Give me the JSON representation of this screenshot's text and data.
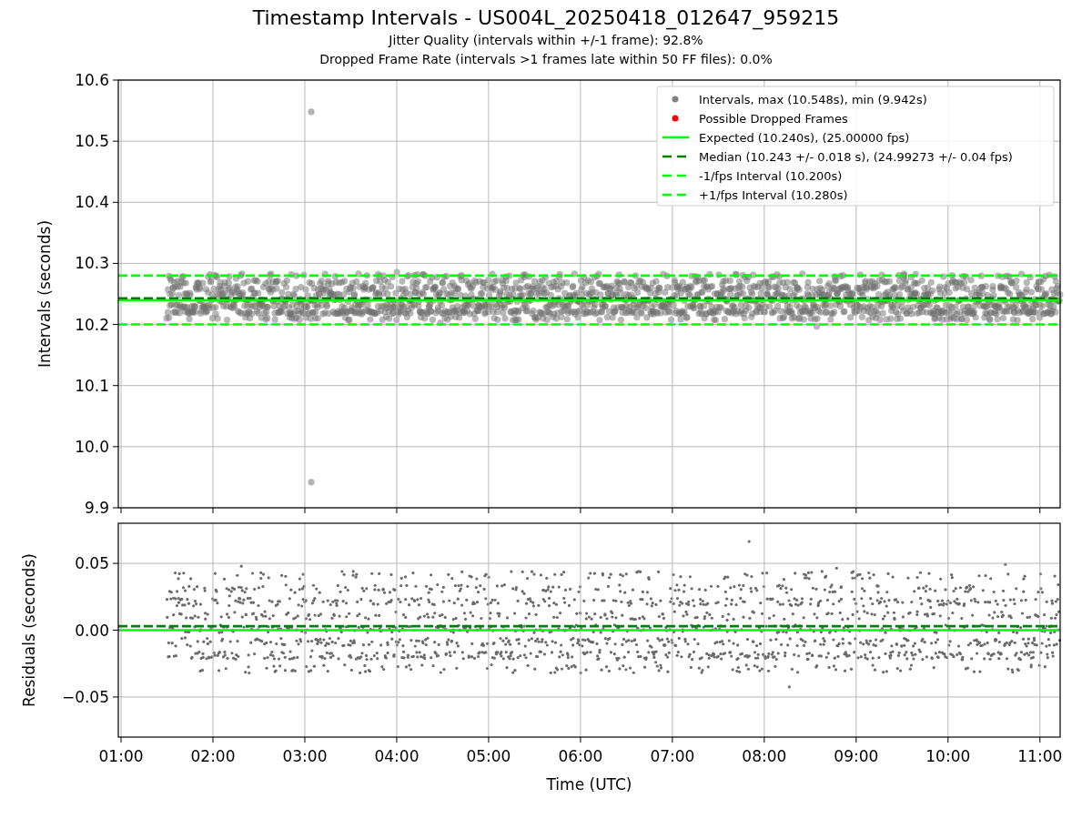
{
  "figure": {
    "title": "Timestamp Intervals - US004L_20250418_012647_959215",
    "subtitles": [
      "Jitter Quality (intervals within +/-1 frame): 92.8%",
      "Dropped Frame Rate (intervals >1 frames late within 50 FF files): 0.0%"
    ]
  },
  "top_panel": {
    "chart_data": {
      "type": "scatter",
      "ylabel": "Intervals (seconds)",
      "grid": true,
      "legend": "upper right",
      "xlim": [
        0.97,
        11.22
      ],
      "ylim": [
        9.9,
        10.6
      ],
      "yticks": [
        {
          "value": 9.9,
          "label": "9.9"
        },
        {
          "value": 10.0,
          "label": "10.0"
        },
        {
          "value": 10.1,
          "label": "10.1"
        },
        {
          "value": 10.2,
          "label": "10.2"
        },
        {
          "value": 10.3,
          "label": "10.3"
        },
        {
          "value": 10.4,
          "label": "10.4"
        },
        {
          "value": 10.5,
          "label": "10.5"
        },
        {
          "value": 10.6,
          "label": "10.6"
        }
      ],
      "series": [
        {
          "name": "Intervals, max (10.548s), min (9.942s)",
          "color": "#808080",
          "type": "scatter",
          "x": [
            3.07,
            3.07
          ],
          "values": [
            10.548,
            9.942
          ]
        },
        {
          "name": "Possible Dropped Frames",
          "color": "#ff0000",
          "type": "scatter"
        },
        {
          "name": "Expected (10.240s), (25.00000 fps)",
          "color": "#00ff00",
          "type": "line",
          "line_style": "solid",
          "x": [
            0.97,
            11.22
          ],
          "values": [
            10.24,
            10.24
          ]
        },
        {
          "name": "Median (10.243 +/- 0.018 s), (24.99273 +/- 0.04 fps)",
          "color": "#008000",
          "type": "line",
          "line_style": "dashed",
          "x": [
            0.97,
            11.22
          ],
          "values": [
            10.243,
            10.243
          ]
        },
        {
          "name": "-1/fps Interval (10.200s)",
          "color": "#00ff00",
          "type": "line",
          "line_style": "dashed",
          "x": [
            0.97,
            11.22
          ],
          "values": [
            10.2,
            10.2
          ]
        },
        {
          "name": "+1/fps Interval (10.280s)",
          "color": "#00ff00",
          "type": "line",
          "line_style": "dashed",
          "x": [
            0.97,
            11.22
          ],
          "values": [
            10.28,
            10.28
          ]
        }
      ]
    }
  },
  "bottom_panel": {
    "chart_data": {
      "type": "scatter",
      "xlabel": "Time (UTC)",
      "ylabel": "Residuals (seconds)",
      "grid": true,
      "xlim": [
        0.97,
        11.22
      ],
      "ylim": [
        -0.08,
        0.08
      ],
      "xticks": [
        {
          "value": 1,
          "label": "01:00"
        },
        {
          "value": 2,
          "label": "02:00"
        },
        {
          "value": 3,
          "label": "03:00"
        },
        {
          "value": 4,
          "label": "04:00"
        },
        {
          "value": 5,
          "label": "05:00"
        },
        {
          "value": 6,
          "label": "06:00"
        },
        {
          "value": 7,
          "label": "07:00"
        },
        {
          "value": 8,
          "label": "08:00"
        },
        {
          "value": 9,
          "label": "09:00"
        },
        {
          "value": 10,
          "label": "10:00"
        },
        {
          "value": 11,
          "label": "11:00"
        }
      ],
      "yticks": [
        {
          "value": -0.05,
          "label": "−0.05"
        },
        {
          "value": 0,
          "label": "0.00"
        },
        {
          "value": 0.05,
          "label": "0.05"
        }
      ],
      "ref_lines": [
        {
          "axis": "y",
          "value": 0.003,
          "color": "#008000",
          "line_style": "dashed"
        },
        {
          "axis": "y",
          "value": 0,
          "color": "#00ff00",
          "line_style": "solid"
        }
      ]
    }
  }
}
